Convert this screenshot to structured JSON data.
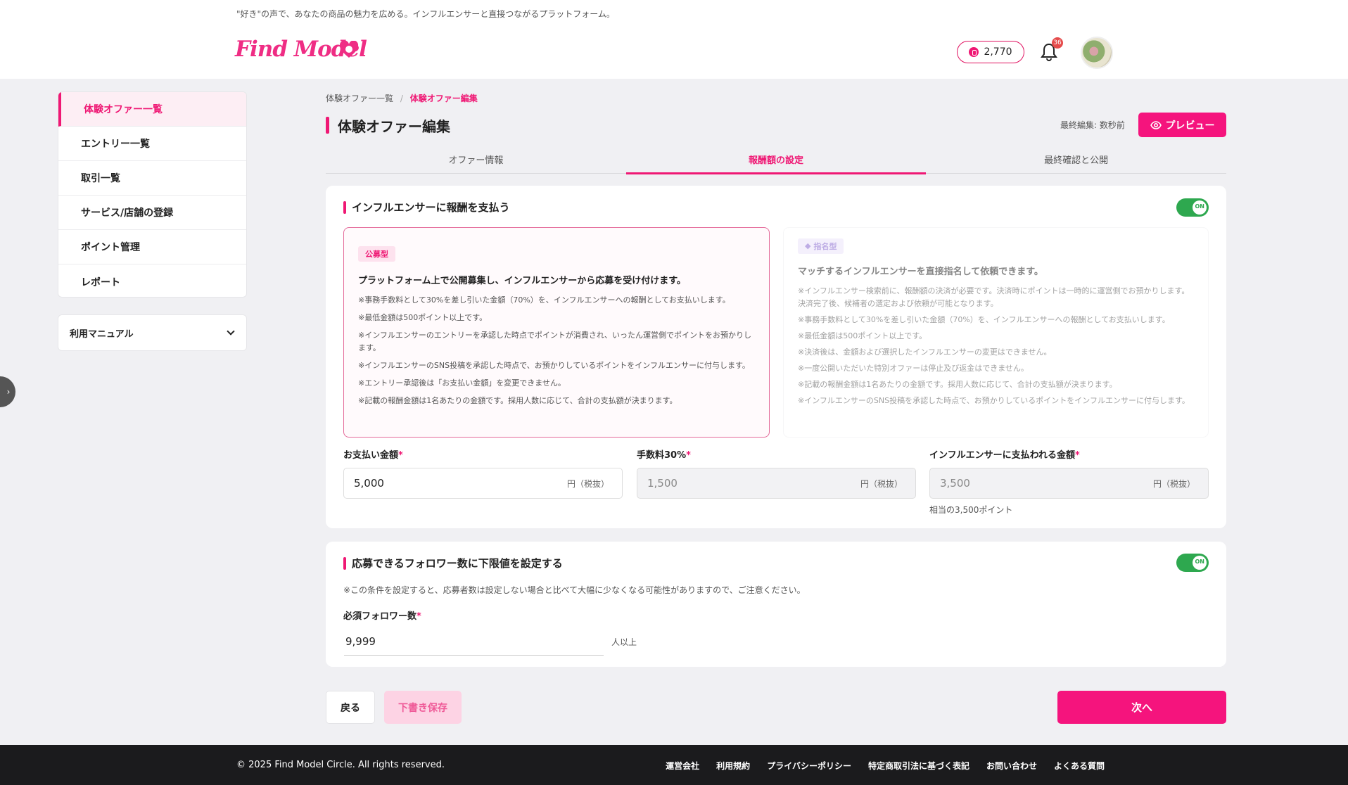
{
  "header": {
    "tagline": "\"好き\"の声で、あなたの商品の魅力を広める。インフルエンサーと直接つながるプラットフォーム。",
    "logo_text": "Find Model",
    "points": "2,770",
    "notification_count": "36",
    "accent_color": "#ef1874"
  },
  "sidebar": {
    "items": [
      {
        "label": "体験オファー一覧"
      },
      {
        "label": "エントリー一覧"
      },
      {
        "label": "取引一覧"
      },
      {
        "label": "サービス/店舗の登録"
      },
      {
        "label": "ポイント管理"
      },
      {
        "label": "レポート"
      }
    ],
    "manual_label": "利用マニュアル"
  },
  "breadcrumb": {
    "parent": "体験オファー一覧",
    "separator": "/",
    "current": "体験オファー編集"
  },
  "page": {
    "title": "体験オファー編集",
    "last_edited": "最終編集: 数秒前",
    "preview_label": "プレビュー"
  },
  "tabs": [
    {
      "label": "オファー情報"
    },
    {
      "label": "報酬額の設定"
    },
    {
      "label": "最終確認と公開"
    }
  ],
  "reward_section": {
    "title": "インフルエンサーに報酬を支払う",
    "toggle_label": "ON",
    "public_option": {
      "badge": "公募型",
      "heading": "プラットフォーム上で公開募集し、インフルエンサーから応募を受け付けます。",
      "notes": [
        "※事務手数料として30%を差し引いた金額（70%）を、インフルエンサーへの報酬としてお支払いします。",
        "※最低金額は500ポイント以上です。",
        "※インフルエンサーのエントリーを承認した時点でポイントが消費され、いったん運営側でポイントをお預かりします。",
        "※インフルエンサーのSNS投稿を承認した時点で、お預かりしているポイントをインフルエンサーに付与します。",
        "※エントリー承認後は「お支払い金額」を変更できません。",
        "※記載の報酬金額は1名あたりの金額です。採用人数に応じて、合計の支払額が決まります。"
      ]
    },
    "nominate_option": {
      "badge": "指名型",
      "heading": "マッチするインフルエンサーを直接指名して依頼できます。",
      "notes": [
        "※インフルエンサー検索前に、報酬額の決済が必要です。決済時にポイントは一時的に運営側でお預かりします。決済完了後、候補者の選定および依頼が可能となります。",
        "※事務手数料として30%を差し引いた金額（70%）を、インフルエンサーへの報酬としてお支払いします。",
        "※最低金額は500ポイント以上です。",
        "※決済後は、金額および選択したインフルエンサーの変更はできません。",
        "※一度公開いただいた特別オファーは停止及び返金はできません。",
        "※記載の報酬金額は1名あたりの金額です。採用人数に応じて、合計の支払額が決まります。",
        "※インフルエンサーのSNS投稿を承認した時点で、お預かりしているポイントをインフルエンサーに付与します。"
      ]
    },
    "fields": {
      "payment_label": "お支払い金額",
      "payment_value": "5,000",
      "fee_label": "手数料30%",
      "fee_value": "1,500",
      "influencer_label": "インフルエンサーに支払われる金額",
      "influencer_value": "3,500",
      "unit": "円（税抜）",
      "required_mark": "*",
      "points_hint": "相当の3,500ポイント"
    }
  },
  "follower_section": {
    "title": "応募できるフォロワー数に下限値を設定する",
    "toggle_label": "ON",
    "note": "※この条件を設定すると、応募者数は設定しない場合と比べて大幅に少なくなる可能性がありますので、ご注意ください。",
    "field_label": "必須フォロワー数",
    "required_mark": "*",
    "value": "9,999",
    "suffix": "人以上"
  },
  "actions": {
    "back": "戻る",
    "save_draft": "下書き保存",
    "next": "次へ"
  },
  "footer": {
    "copyright": "© 2025 Find Model Circle. All rights reserved.",
    "links": [
      "運営会社",
      "利用規約",
      "プライバシーポリシー",
      "特定商取引法に基づく表記",
      "お問い合わせ",
      "よくある質問"
    ]
  }
}
